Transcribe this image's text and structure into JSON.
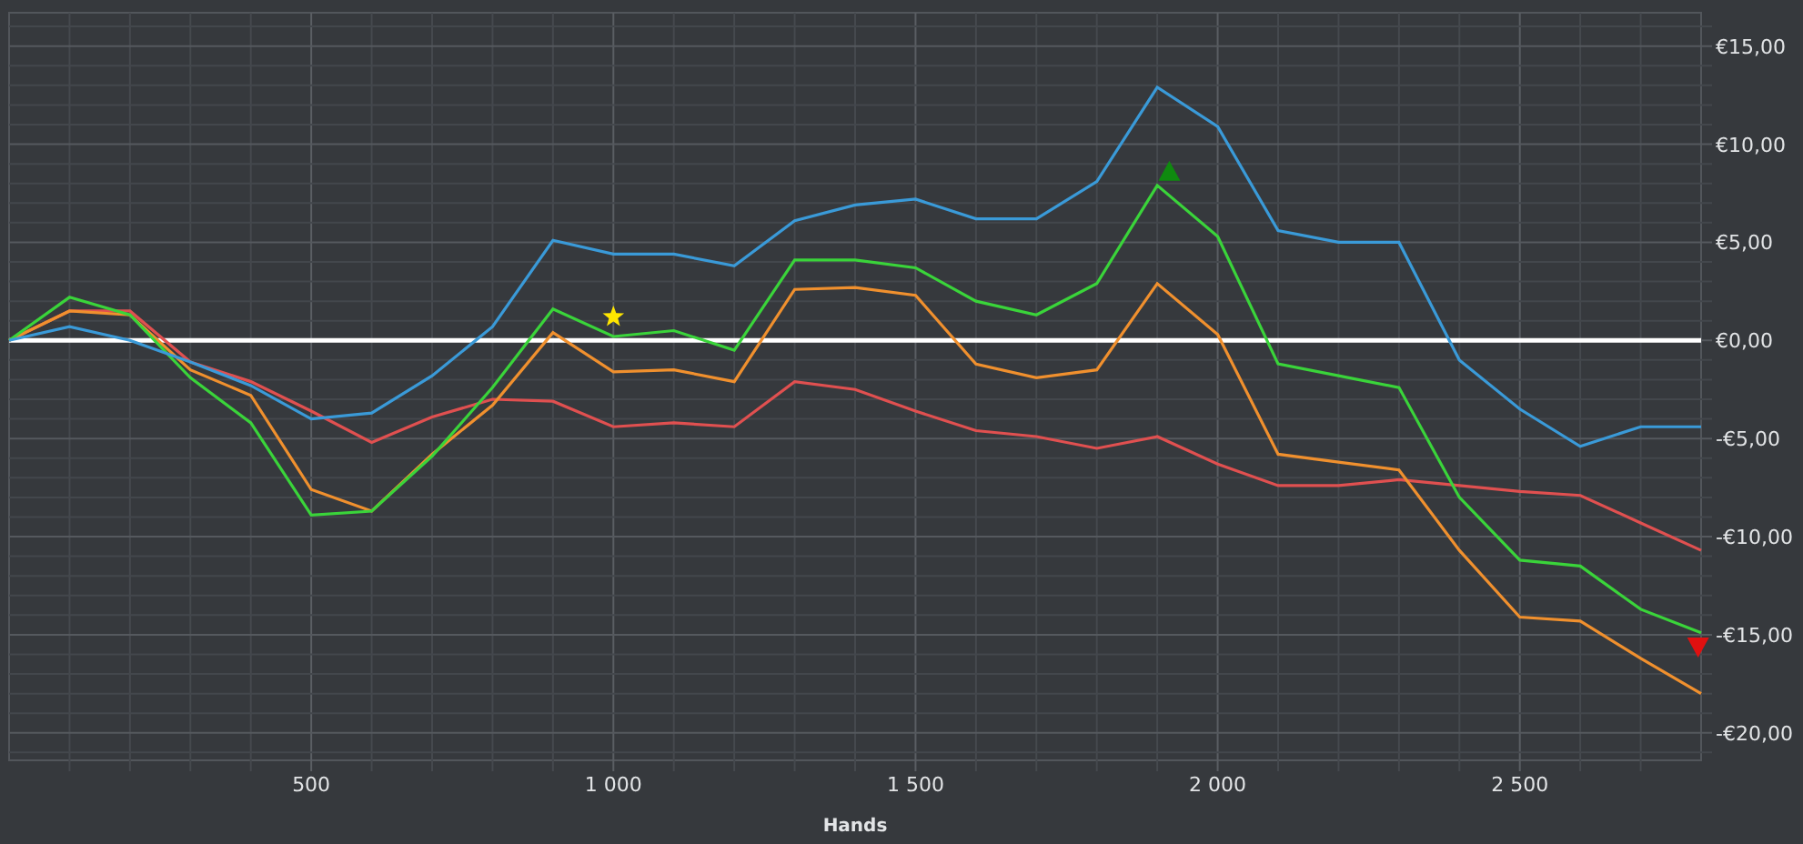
{
  "chart": {
    "chart_data": {
      "type": "line",
      "grid": true,
      "xlabel": "Hands",
      "xlim": [
        0,
        2800
      ],
      "ylim": [
        -21.4,
        16.7
      ],
      "x": [
        0,
        100,
        200,
        300,
        400,
        500,
        600,
        700,
        800,
        900,
        1000,
        1100,
        1200,
        1300,
        1400,
        1500,
        1600,
        1700,
        1800,
        1900,
        2000,
        2100,
        2200,
        2300,
        2400,
        2500,
        2600,
        2700,
        2800
      ],
      "xticks": [
        {
          "value": 500,
          "label": "500"
        },
        {
          "value": 1000,
          "label": "1 000"
        },
        {
          "value": 1500,
          "label": "1 500"
        },
        {
          "value": 2000,
          "label": "2 000"
        },
        {
          "value": 2500,
          "label": "2 500"
        }
      ],
      "yticks": [
        {
          "value": 15,
          "label": "€15,00"
        },
        {
          "value": 10,
          "label": "€10,00"
        },
        {
          "value": 5,
          "label": "€5,00"
        },
        {
          "value": 0,
          "label": "€0,00"
        },
        {
          "value": -5,
          "label": "-€5,00"
        },
        {
          "value": -10,
          "label": "-€10,00"
        },
        {
          "value": -15,
          "label": "-€15,00"
        },
        {
          "value": -20,
          "label": "-€20,00"
        }
      ],
      "series": [
        {
          "color": "#e05050",
          "values": [
            0,
            1.5,
            1.5,
            -1.1,
            -2.1,
            -3.6,
            -5.2,
            -3.9,
            -3.0,
            -3.1,
            -4.4,
            -4.2,
            -4.4,
            -2.1,
            -2.5,
            -3.6,
            -4.6,
            -4.9,
            -5.5,
            -4.9,
            -6.3,
            -7.4,
            -7.4,
            -7.1,
            -7.4,
            -7.7,
            -7.9,
            -9.3,
            -10.7
          ]
        },
        {
          "color": "#f0902e",
          "values": [
            0,
            1.5,
            1.3,
            -1.5,
            -2.8,
            -7.6,
            -8.7,
            -5.8,
            -3.3,
            0.4,
            -1.6,
            -1.5,
            -2.1,
            2.6,
            2.7,
            2.3,
            -1.2,
            -1.9,
            -1.5,
            2.9,
            0.3,
            -5.8,
            -6.2,
            -6.6,
            -10.7,
            -14.1,
            -14.3,
            -16.2,
            -18.0
          ]
        },
        {
          "color": "#3ad43a",
          "values": [
            0,
            2.2,
            1.3,
            -1.9,
            -4.2,
            -8.9,
            -8.7,
            -5.9,
            -2.4,
            1.6,
            0.2,
            0.5,
            -0.5,
            4.1,
            4.1,
            3.7,
            2.0,
            1.3,
            2.9,
            7.9,
            5.3,
            -1.2,
            -1.8,
            -2.4,
            -8.0,
            -11.2,
            -11.5,
            -13.7,
            -14.9
          ]
        },
        {
          "color": "#3a9ad8",
          "values": [
            0,
            0.7,
            0,
            -1.1,
            -2.3,
            -4.0,
            -3.7,
            -1.8,
            0.7,
            5.1,
            4.4,
            4.4,
            3.8,
            6.1,
            6.9,
            7.2,
            6.2,
            6.2,
            8.1,
            12.9,
            10.9,
            5.6,
            5.0,
            5.0,
            -1.0,
            -3.5,
            -5.4,
            -4.4,
            -4.4
          ]
        }
      ]
    }
  }
}
